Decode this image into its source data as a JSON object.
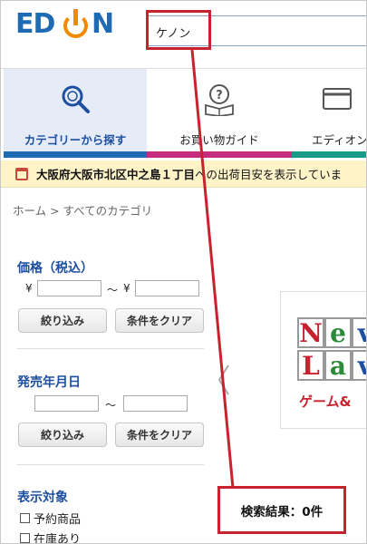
{
  "header": {
    "logo_text_left": "ED",
    "logo_text_right": "N",
    "search_value": "ケノン"
  },
  "nav": {
    "tabs": [
      {
        "label": "カテゴリーから探す",
        "icon": "magnifier-icon",
        "color": "#1e6ab3"
      },
      {
        "label": "お買い物ガイド",
        "icon": "guide-book-icon",
        "color": "#c62d7f"
      },
      {
        "label": "エディオン",
        "icon": "card-icon",
        "color": "#1a9b8a"
      }
    ]
  },
  "delivery": {
    "address": "大阪府大阪市北区中之島１丁目",
    "rest": "への出荷目安を表示していま"
  },
  "breadcrumb": "ホーム > すべてのカテゴリ",
  "filters": {
    "price_title": "価格（税込）",
    "currency": "¥",
    "range_sep": "〜",
    "narrow_button": "絞り込み",
    "clear_button": "条件をクリア",
    "release_title": "発売年月日",
    "display_title": "表示対象",
    "display_options": [
      "予約商品",
      "在庫あり"
    ]
  },
  "banner": {
    "row1": [
      "N",
      "e",
      "v"
    ],
    "row2": [
      "L",
      "a",
      "v"
    ],
    "tagline": "ゲーム&"
  },
  "result_text": "検索結果：0件",
  "colors": {
    "accent_red": "#c8222e",
    "brand_blue": "#1e6ab3",
    "brand_orange": "#f08a00",
    "delivery_bg": "#fff3c8"
  }
}
